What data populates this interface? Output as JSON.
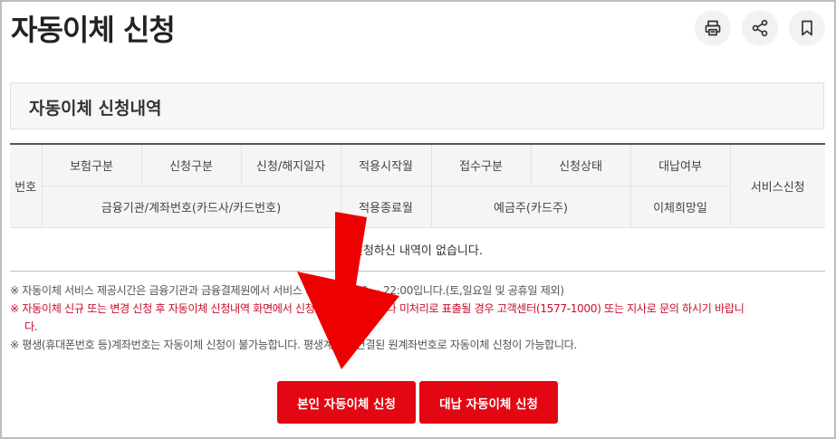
{
  "page": {
    "title": "자동이체 신청"
  },
  "toolbar": {
    "icons": [
      "printer-icon",
      "share-icon",
      "bookmark-icon"
    ]
  },
  "section": {
    "title": "자동이체 신청내역"
  },
  "table": {
    "header_row1": [
      "번호",
      "보험구분",
      "신청구분",
      "신청/해지일자",
      "적용시작월",
      "접수구분",
      "신청상태",
      "대납여부",
      "서비스신청"
    ],
    "header_row2": [
      "금융기관/계좌번호(카드사/카드번호)",
      "적용종료월",
      "예금주(카드주)",
      "이체희망일"
    ],
    "empty_message": "신청하신 내역이 없습니다."
  },
  "notes": [
    "※ 자동이체 서비스 제공시간은 금융기관과 금융결제원에서 서비스 가능한 09:00 ~ 22:00입니다.(토,일요일 및 공휴일 제외)",
    "※ 자동이체 신규 또는 변경 신청 후 자동이체 신청내역 화면에서 신청상태가 오류이거나 미처리로 표출될 경우 고객센터(1577-1000) 또는 지사로 문의 하시기 바랍니",
    "다.",
    "※ 평생(휴대폰번호 등)계좌번호는 자동이체 신청이 불가능합니다. 평생계좌와 연결된 원계좌번호로 자동이체 신청이 가능합니다."
  ],
  "buttons": {
    "self_apply": "본인 자동이체 신청",
    "proxy_apply": "대납 자동이체 신청"
  },
  "colors": {
    "accent": "#e30613",
    "arrow": "#ee0000"
  }
}
